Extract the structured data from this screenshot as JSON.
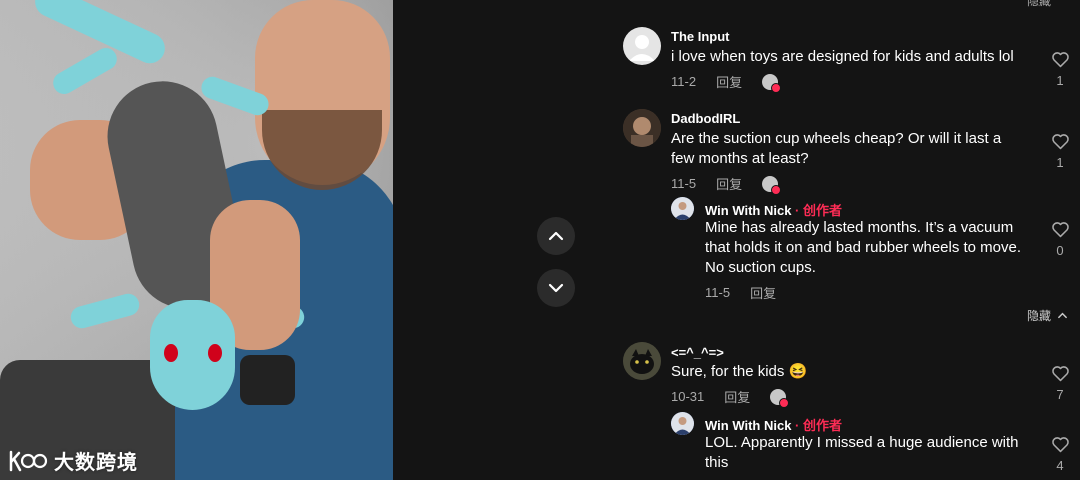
{
  "watermark": {
    "text": "大数跨境",
    "logo_text": "k"
  },
  "top_hide": "隐藏",
  "nav": {
    "up_icon": "chevron-up-icon",
    "down_icon": "chevron-down-icon"
  },
  "comments": [
    {
      "username": "The Input",
      "text": "i love when toys are designed for kids and adults lol",
      "date": "11-2",
      "reply": "回复",
      "likes": "1",
      "avatar_color": "#e5e5e5"
    },
    {
      "username": "DadbodIRL",
      "text": "Are the suction cup wheels cheap? Or will it last a few months at least?",
      "date": "11-5",
      "reply": "回复",
      "likes": "1",
      "avatar_color": "#5a4636"
    },
    {
      "username": "Win With Nick",
      "badge_sep": " · ",
      "badge": "创作者",
      "text": "Mine has already lasted months. It’s a vacuum that holds it on and bad rubber wheels to move. No suction cups.",
      "date": "11-5",
      "reply": "回复",
      "likes": "0",
      "avatar_color": "#3b5fa8"
    },
    {
      "username": "<=^_^=>",
      "text": "Sure, for the kids 😆",
      "date": "10-31",
      "reply": "回复",
      "likes": "7",
      "avatar_color": "#2a2a22"
    },
    {
      "username": "Win With Nick",
      "badge_sep": " · ",
      "badge": "创作者",
      "text": "LOL. Apparently I missed a huge audience with this",
      "likes": "4",
      "avatar_color": "#3b5fa8"
    }
  ],
  "hide_label": "隐藏"
}
